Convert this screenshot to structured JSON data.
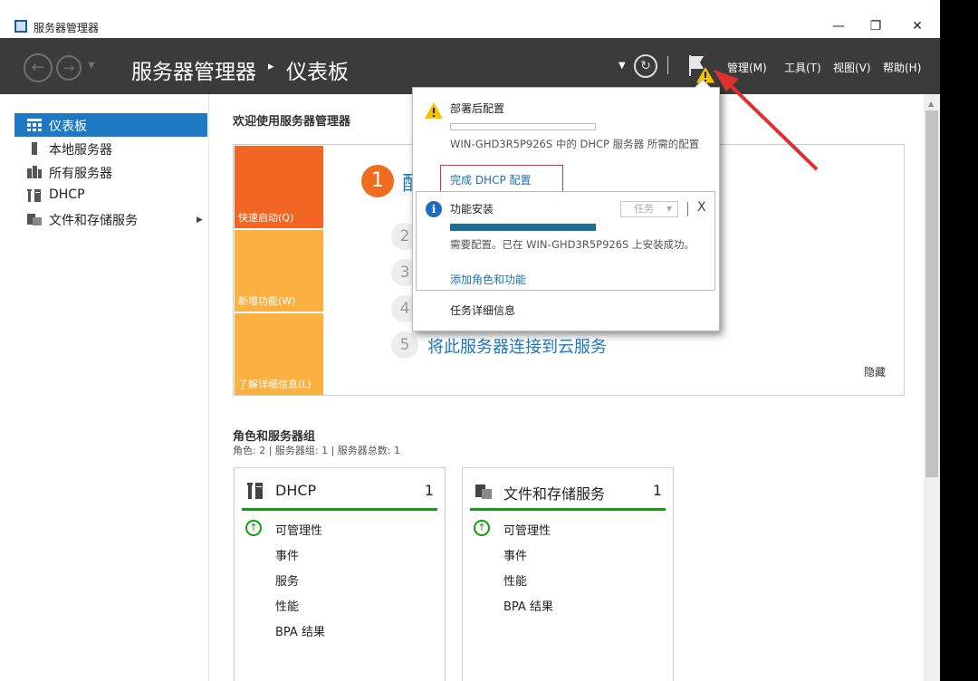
{
  "window": {
    "title": "服务器管理器",
    "controls": {
      "minimize": "—",
      "restore": "❐",
      "close": "✕"
    }
  },
  "header": {
    "breadcrumb_root": "服务器管理器",
    "breadcrumb_separator": "▸",
    "breadcrumb_page": "仪表板",
    "menus": [
      "管理(M)",
      "工具(T)",
      "视图(V)",
      "帮助(H)"
    ]
  },
  "sidebar": {
    "items": [
      {
        "label": "仪表板",
        "icon": "dashboard-icon",
        "active": true
      },
      {
        "label": "本地服务器",
        "icon": "local-server-icon",
        "active": false
      },
      {
        "label": "所有服务器",
        "icon": "all-servers-icon",
        "active": false
      },
      {
        "label": "DHCP",
        "icon": "dhcp-icon",
        "active": false
      },
      {
        "label": "文件和存储服务",
        "icon": "file-storage-icon",
        "active": false,
        "expandable": true
      }
    ]
  },
  "welcome": {
    "title": "欢迎使用服务器管理器",
    "tiles": [
      "快速启动(Q)",
      "新增功能(W)",
      "了解详细信息(L)"
    ],
    "step1": {
      "num": "1",
      "text": "配"
    },
    "steps": [
      {
        "num": "2",
        "text": ""
      },
      {
        "num": "3",
        "text": ""
      },
      {
        "num": "4",
        "text": ""
      },
      {
        "num": "5",
        "text": "将此服务器连接到云服务"
      }
    ],
    "hide": "隐藏"
  },
  "roles": {
    "title": "角色和服务器组",
    "summary": "角色: 2 | 服务器组: 1 | 服务器总数: 1",
    "cards": [
      {
        "name": "DHCP",
        "count": "1",
        "icon": "dhcp-icon",
        "rows": [
          "可管理性",
          "事件",
          "服务",
          "性能",
          "BPA 结果"
        ]
      },
      {
        "name": "文件和存储服务",
        "count": "1",
        "icon": "file-storage-icon",
        "rows": [
          "可管理性",
          "事件",
          "性能",
          "BPA 结果"
        ]
      }
    ]
  },
  "notifications": {
    "post_deploy": {
      "title": "部署后配置",
      "description": "WIN-GHD3R5P926S 中的 DHCP 服务器 所需的配置",
      "link": "完成 DHCP 配置"
    },
    "feature_install": {
      "title": "功能安装",
      "task_dropdown": "任务",
      "close": "X",
      "progress": 1.0,
      "description": "需要配置。已在 WIN-GHD3R5P926S 上安装成功。",
      "link": "添加角色和功能"
    },
    "task_details": "任务详细信息"
  },
  "colors": {
    "header_bg": "#3b3b3b",
    "active_blue": "#1d79c4",
    "quick_start_orange": "#f26522",
    "tile_orange": "#fbb040",
    "ok_green": "#10a010",
    "warning_yellow": "#f6c100",
    "annotation_red": "#e0302e"
  }
}
